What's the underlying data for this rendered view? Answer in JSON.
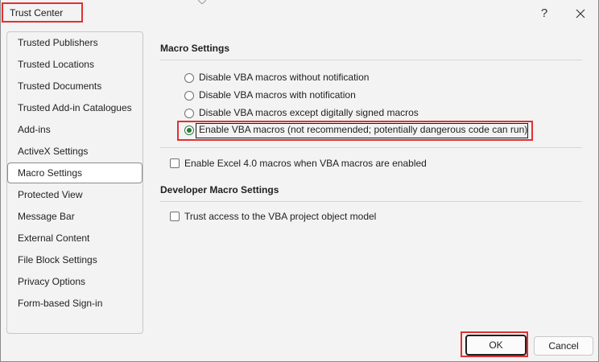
{
  "window": {
    "title": "Trust Center"
  },
  "titlebar": {
    "help_glyph": "?",
    "help_icon": "question-icon",
    "close_icon": "close-icon"
  },
  "nav": {
    "items": [
      {
        "label": "Trusted Publishers",
        "selected": false
      },
      {
        "label": "Trusted Locations",
        "selected": false
      },
      {
        "label": "Trusted Documents",
        "selected": false
      },
      {
        "label": "Trusted Add-in Catalogues",
        "selected": false
      },
      {
        "label": "Add-ins",
        "selected": false
      },
      {
        "label": "ActiveX Settings",
        "selected": false
      },
      {
        "label": "Macro Settings",
        "selected": true
      },
      {
        "label": "Protected View",
        "selected": false
      },
      {
        "label": "Message Bar",
        "selected": false
      },
      {
        "label": "External Content",
        "selected": false
      },
      {
        "label": "File Block Settings",
        "selected": false
      },
      {
        "label": "Privacy Options",
        "selected": false
      },
      {
        "label": "Form-based Sign-in",
        "selected": false
      }
    ]
  },
  "macro_settings": {
    "title": "Macro Settings",
    "options": [
      {
        "label": "Disable VBA macros without notification",
        "checked": false
      },
      {
        "label": "Disable VBA macros with notification",
        "checked": false
      },
      {
        "label": "Disable VBA macros except digitally signed macros",
        "checked": false
      },
      {
        "label": "Enable VBA macros (not recommended; potentially dangerous code can run)",
        "checked": true
      }
    ],
    "excel4_label": "Enable Excel 4.0 macros when VBA macros are enabled",
    "excel4_checked": false
  },
  "developer": {
    "title": "Developer Macro Settings",
    "trust_vba_label": "Trust access to the VBA project object model",
    "trust_vba_checked": false
  },
  "footer": {
    "ok_label": "OK",
    "cancel_label": "Cancel"
  },
  "colors": {
    "highlight": "#e03131",
    "radio_accent": "#2b7a3b"
  }
}
